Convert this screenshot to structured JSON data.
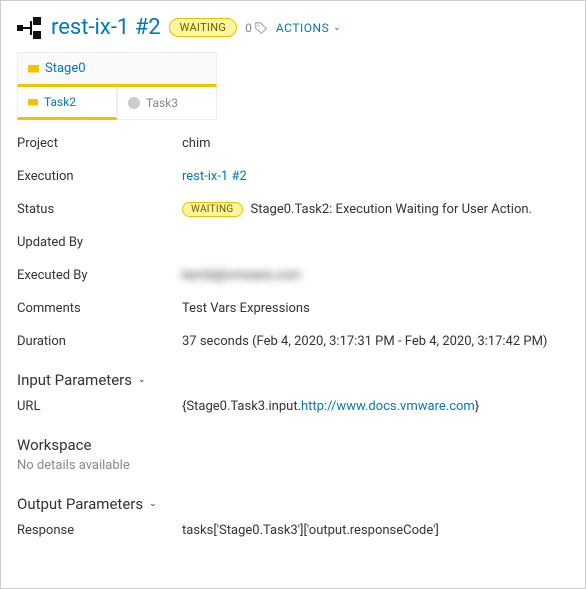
{
  "header": {
    "title": "rest-ix-1 #2",
    "status_badge": "WAITING",
    "tag_count": "0",
    "actions_label": "ACTIONS"
  },
  "stages": {
    "stage_label": "Stage0",
    "task_active": "Task2",
    "task_inactive": "Task3"
  },
  "details": {
    "project_label": "Project",
    "project_value": "chim",
    "execution_label": "Execution",
    "execution_value": "rest-ix-1 #2",
    "status_label": "Status",
    "status_badge": "WAITING",
    "status_text": "Stage0.Task2: Execution Waiting for User Action.",
    "updated_by_label": "Updated By",
    "updated_by_value": "",
    "executed_by_label": "Executed By",
    "executed_by_value": "kernb@vmware.com",
    "comments_label": "Comments",
    "comments_value": "Test Vars Expressions",
    "duration_label": "Duration",
    "duration_value": "37 seconds (Feb 4, 2020, 3:17:31 PM - Feb 4, 2020, 3:17:42 PM)"
  },
  "input_params": {
    "heading": "Input Parameters",
    "url_label": "URL",
    "url_prefix": "{Stage0.Task3.input.",
    "url_link": "http://www.docs.vmware.com",
    "url_suffix": "}"
  },
  "workspace": {
    "heading": "Workspace",
    "empty": "No details available"
  },
  "output_params": {
    "heading": "Output Parameters",
    "response_label": "Response",
    "response_value": "tasks['Stage0.Task3']['output.responseCode']"
  }
}
